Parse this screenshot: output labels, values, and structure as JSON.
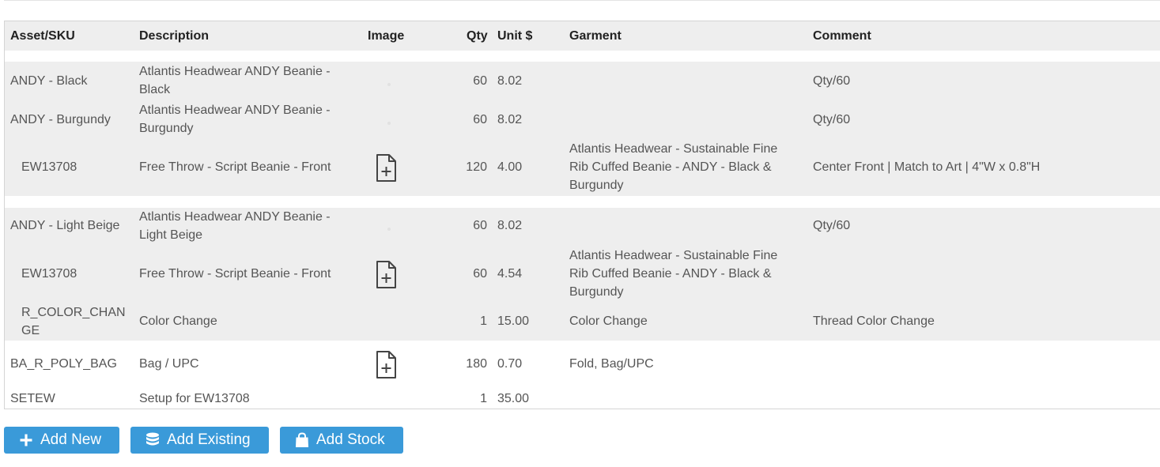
{
  "table": {
    "headers": {
      "sku": "Asset/SKU",
      "description": "Description",
      "image": "Image",
      "qty": "Qty",
      "unit": "Unit $",
      "garment": "Garment",
      "comment": "Comment"
    },
    "rows": [
      {
        "sku": [
          "ANDY - Black"
        ],
        "description": [
          "Atlantis Headwear ANDY Beanie -",
          "Black"
        ],
        "image": "placeholder",
        "qty": "60",
        "unit": "8.02",
        "garment": [],
        "comment": "Qty/60"
      },
      {
        "sku": [
          "ANDY - Burgundy"
        ],
        "description": [
          "Atlantis Headwear ANDY Beanie -",
          "Burgundy"
        ],
        "image": "placeholder",
        "qty": "60",
        "unit": "8.02",
        "garment": [],
        "comment": "Qty/60"
      },
      {
        "sku": [
          "EW13708"
        ],
        "description": [
          "Free Throw - Script Beanie - Front"
        ],
        "image": "file-plus-icon",
        "qty": "120",
        "unit": "4.00",
        "garment": [
          "Atlantis Headwear - Sustainable Fine",
          "Rib Cuffed Beanie - ANDY - Black &",
          "Burgundy"
        ],
        "comment": "Center Front | Match to Art | 4\"W x 0.8\"H"
      },
      {
        "sku": [
          "ANDY - Light Beige"
        ],
        "description": [
          "Atlantis Headwear ANDY Beanie -",
          "Light Beige"
        ],
        "image": "placeholder",
        "qty": "60",
        "unit": "8.02",
        "garment": [],
        "comment": "Qty/60"
      },
      {
        "sku": [
          "EW13708"
        ],
        "description": [
          "Free Throw - Script Beanie - Front"
        ],
        "image": "file-plus-icon",
        "qty": "60",
        "unit": "4.54",
        "garment": [
          "Atlantis Headwear - Sustainable Fine",
          "Rib Cuffed Beanie - ANDY - Black &",
          "Burgundy"
        ],
        "comment": ""
      },
      {
        "sku": [
          "R_COLOR_CHAN",
          "GE"
        ],
        "description": [
          "Color Change"
        ],
        "image": "",
        "qty": "1",
        "unit": "15.00",
        "garment": [
          "Color Change"
        ],
        "comment": "Thread Color Change"
      },
      {
        "sku": [
          "BA_R_POLY_BAG"
        ],
        "description": [
          "Bag / UPC"
        ],
        "image": "file-plus-icon",
        "qty": "180",
        "unit": "0.70",
        "garment": [
          "Fold, Bag/UPC"
        ],
        "comment": ""
      },
      {
        "sku": [
          "SETEW"
        ],
        "description": [
          "Setup for EW13708"
        ],
        "image": "",
        "qty": "1",
        "unit": "35.00",
        "garment": [],
        "comment": ""
      }
    ]
  },
  "buttons": {
    "add_new": {
      "label": "Add New",
      "icon": "plus-icon"
    },
    "add_existing": {
      "label": "Add Existing",
      "icon": "database-icon"
    },
    "add_stock": {
      "label": "Add Stock",
      "icon": "shopping-bag-icon"
    }
  },
  "colors": {
    "button_bg": "#3a9ad9",
    "row_group_bg": "#eeeeee",
    "text": "#555555",
    "header_text": "#222222"
  }
}
